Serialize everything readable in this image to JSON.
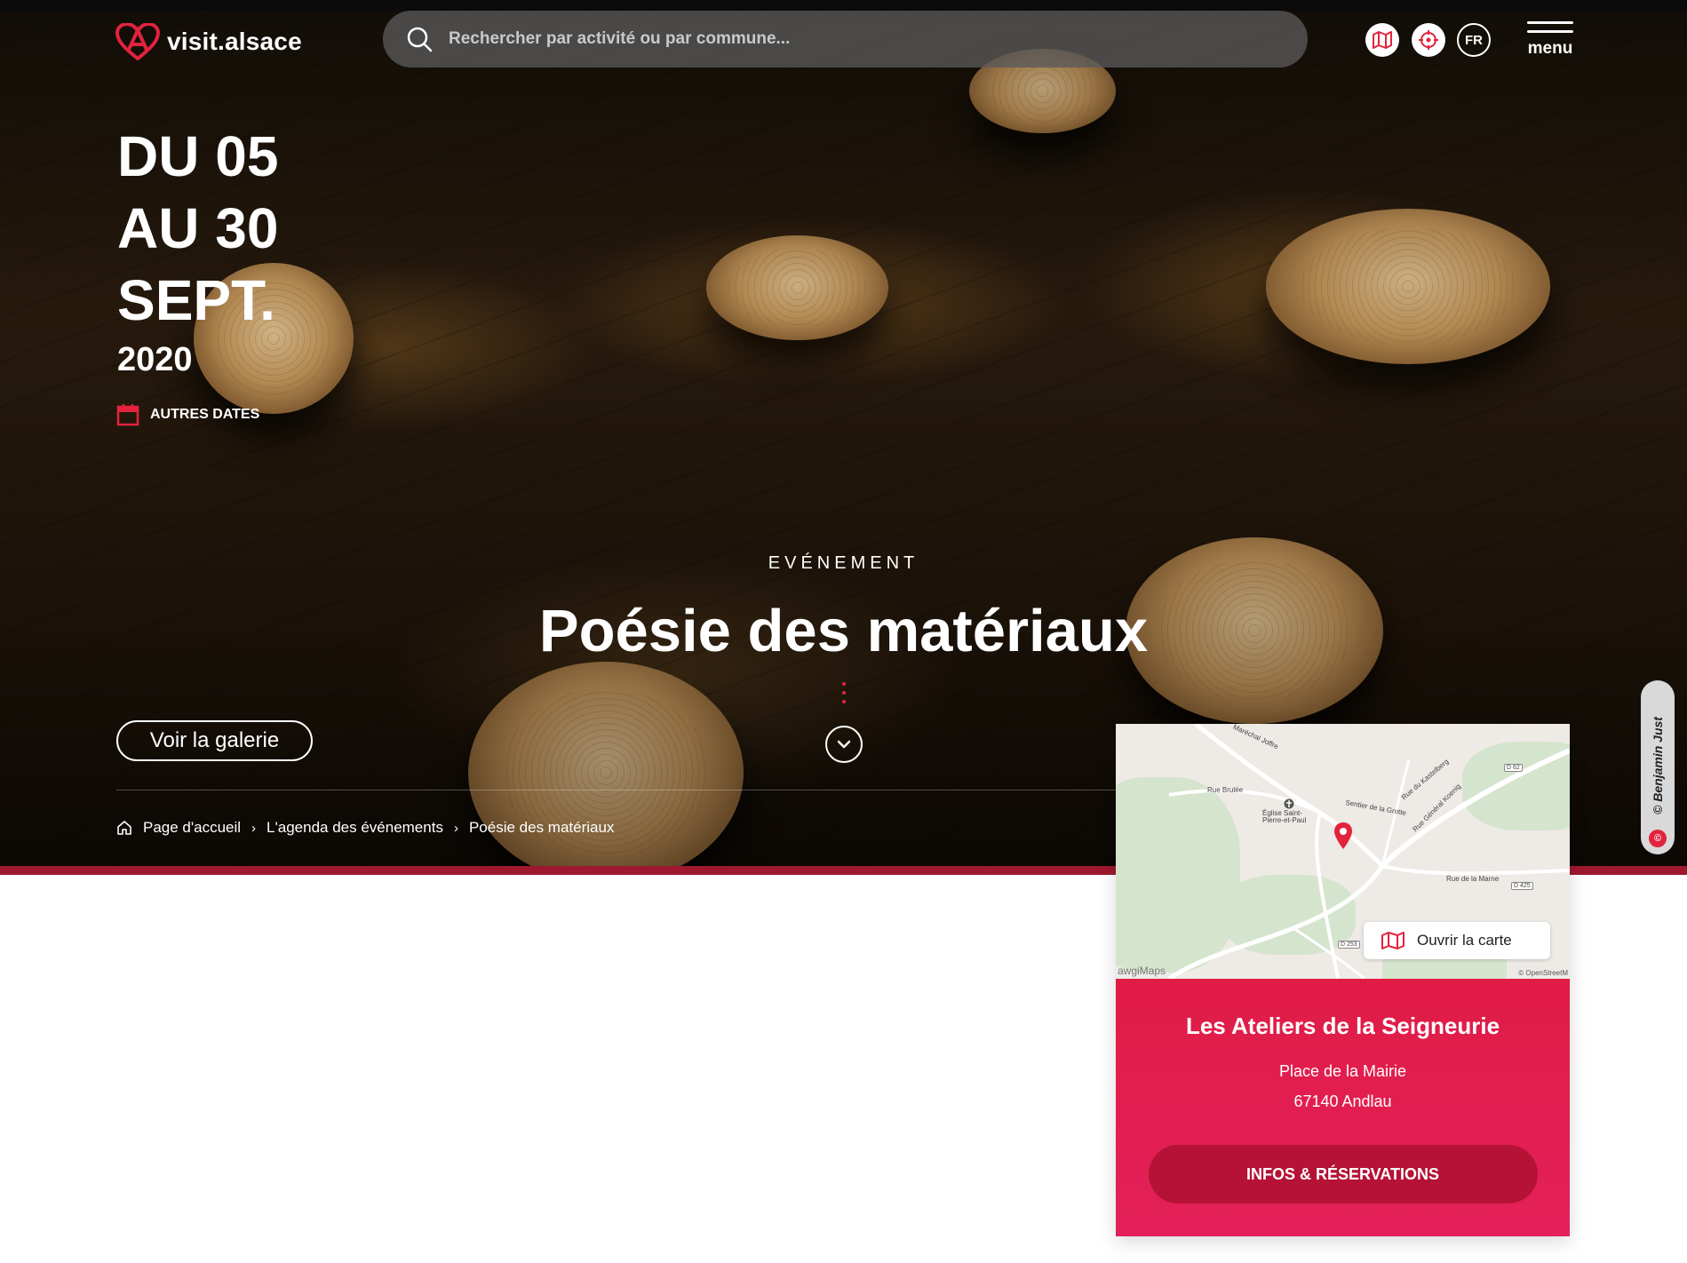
{
  "header": {
    "brand": "visit.alsace",
    "search_placeholder": "Rechercher par activité ou par commune...",
    "lang": "FR",
    "menu_label": "menu",
    "icons": [
      "map-icon",
      "target-icon"
    ]
  },
  "event": {
    "date_line1": "DU 05",
    "date_line2": "AU 30",
    "date_line3": "SEPT.",
    "year": "2020",
    "other_dates": "AUTRES DATES",
    "kicker": "EVÉNEMENT",
    "title": "Poésie des matériaux",
    "gallery_button": "Voir la galerie"
  },
  "breadcrumb": {
    "home": "Page d'accueil",
    "agenda": "L'agenda des événements",
    "current": "Poésie des matériaux"
  },
  "photo_credit": "© Benjamin Just",
  "map": {
    "open_label": "Ouvrir la carte",
    "attribution_left": "awgiMaps",
    "attribution_right": "© OpenStreetM",
    "labels": {
      "rue_brulee": "Rue Brulée",
      "marechal": "Maréchal Joffre",
      "eglise": "Église Saint-Pierre-et-Paul",
      "sentier": "Sentier de la Grotte",
      "rue_general": "Rue Général Koenig",
      "rue_marne": "Rue de la Marne",
      "rue_kastelberg": "Rue du Kastelberg"
    },
    "roads": {
      "d62": "D 62",
      "d425": "D 425",
      "d253": "D 253"
    }
  },
  "venue": {
    "name": "Les Ateliers de la Seigneurie",
    "street": "Place de la Mairie",
    "city": "67140 Andlau",
    "button": "INFOS & RÉSERVATIONS"
  },
  "colors": {
    "accent": "#e2233d",
    "venue_bg": "#e01c45",
    "venue_button": "#b51236",
    "hero_bar": "#9e1830"
  }
}
